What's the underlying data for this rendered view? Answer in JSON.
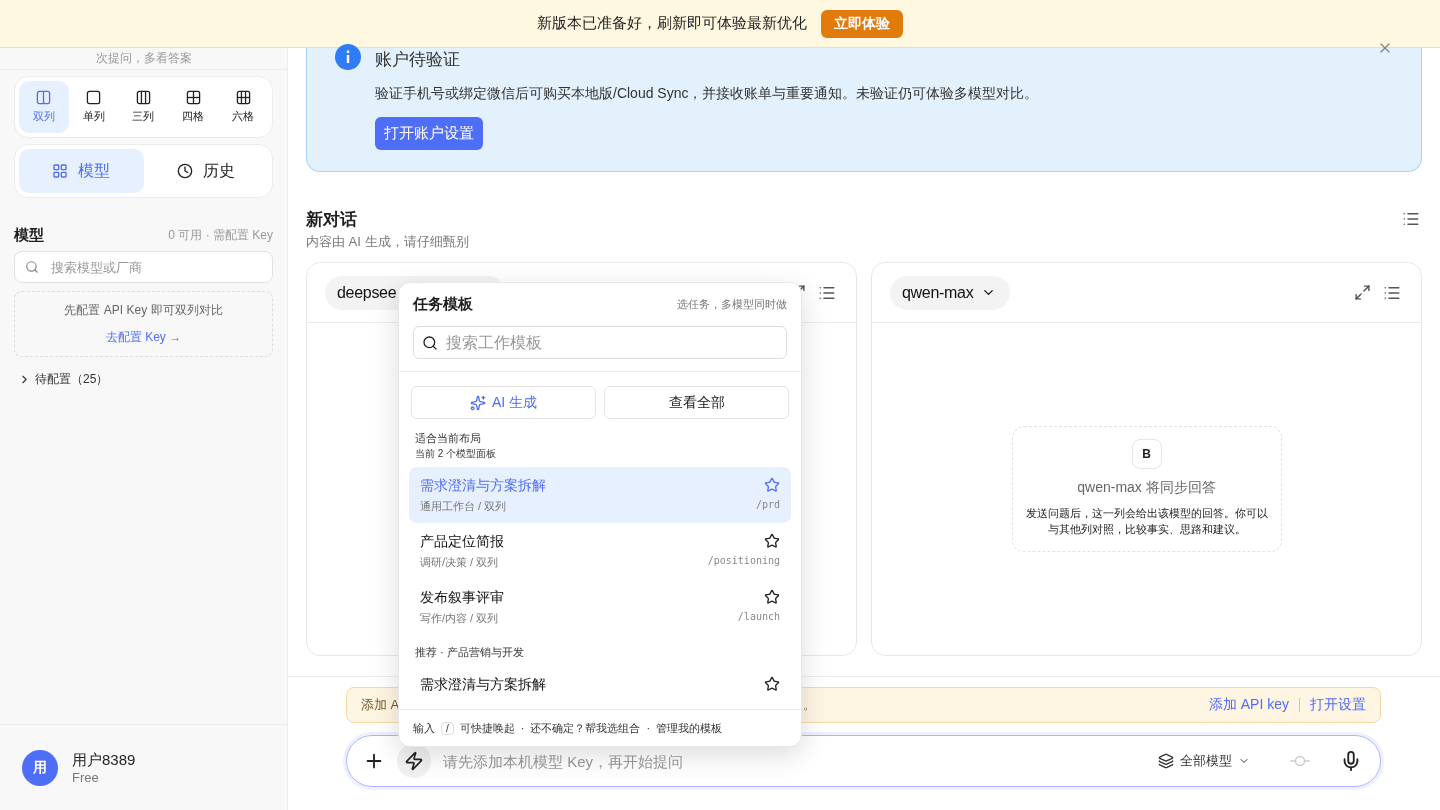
{
  "update_banner": {
    "text": "新版本已准备好，刷新即可体验最新优化",
    "button": "立即体验"
  },
  "sidebar": {
    "hint": "次提问，多看答案",
    "layouts": [
      {
        "label": "双列",
        "kind": "two",
        "selected": true
      },
      {
        "label": "单列",
        "kind": "one",
        "selected": false
      },
      {
        "label": "三列",
        "kind": "three",
        "selected": false
      },
      {
        "label": "四格",
        "kind": "four",
        "selected": false
      },
      {
        "label": "六格",
        "kind": "six",
        "selected": false
      }
    ],
    "tabs": [
      {
        "label": "模型",
        "kind": "grid",
        "selected": true
      },
      {
        "label": "历史",
        "kind": "clock",
        "selected": false
      }
    ],
    "models_title": "模型",
    "models_status": "0 可用 · 需配置 Key",
    "search_placeholder": "搜索模型或厂商",
    "setup_hint": "先配置 API Key 即可双列对比",
    "setup_link": "去配置 Key →",
    "groups": [
      {
        "label": "待配置（25）",
        "expanded": false
      }
    ],
    "user": {
      "avatar": "用",
      "name": "用户8389",
      "plan": "Free"
    }
  },
  "notice": {
    "title": "账户待验证",
    "body": "验证手机号或绑定微信后可购买本地版/Cloud Sync，并接收账单与重要通知。未验证仍可体验多模型对比。",
    "button": "打开账户设置"
  },
  "conversation": {
    "title": "新对话",
    "subtitle": "内容由 AI 生成，请仔细甄别"
  },
  "panels": [
    {
      "model": "deepsee"
    },
    {
      "model": "qwen-max",
      "empty_state": {
        "badge": "B",
        "title": "qwen-max 将同步回答",
        "body": "发送问题后，这一列会给出该模型的回答。你可以与其他列对照，比较事实、思路和建议。"
      }
    }
  ],
  "alert": {
    "text": "添加 A",
    "tail": "。",
    "actions": [
      "添加 API key",
      "打开设置"
    ]
  },
  "composer": {
    "placeholder": "请先添加本机模型 Key，再开始提问",
    "model_filter": "全部模型"
  },
  "template_menu": {
    "title": "任务模板",
    "subtitle": "选任务，多模型同时做",
    "search_placeholder": "搜索工作模板",
    "ai_button": "AI 生成",
    "all_button": "查看全部",
    "sections": [
      {
        "title": "适合当前布局",
        "note": "当前 2 个模型面板",
        "items": [
          {
            "title": "需求澄清与方案拆解",
            "path": "通用工作台 / 双列",
            "command": "/prd",
            "selected": true
          },
          {
            "title": "产品定位简报",
            "path": "调研/决策 / 双列",
            "command": "/positioning",
            "selected": false
          },
          {
            "title": "发布叙事评审",
            "path": "写作/内容 / 双列",
            "command": "/launch",
            "selected": false
          }
        ]
      },
      {
        "title": "推荐 · 产品营销与开发",
        "items": [
          {
            "title": "需求澄清与方案拆解",
            "selected": false
          }
        ]
      }
    ],
    "footer": {
      "prefix": "输入",
      "key": "/",
      "suffix": "可快捷唤起",
      "separator": "·",
      "links": [
        "还不确定？帮我选组合",
        "管理我的模板"
      ]
    }
  }
}
